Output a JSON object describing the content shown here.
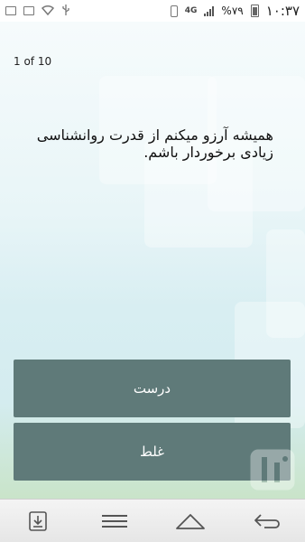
{
  "status_bar": {
    "battery_text": "%۷۹",
    "time": "۱۰:۳۷",
    "network": "4G"
  },
  "quiz": {
    "counter": "1 of 10",
    "question": "همیشه آرزو میکنم از قدرت روانشناسی زیادی برخوردار باشم.",
    "answers": [
      {
        "label": "درست"
      },
      {
        "label": "غلط"
      }
    ]
  },
  "colors": {
    "button_bg": "#5f7a79",
    "button_text": "#ffffff"
  },
  "nav": {
    "icons": [
      "download-icon",
      "menu-icon",
      "home-icon",
      "back-icon"
    ]
  }
}
